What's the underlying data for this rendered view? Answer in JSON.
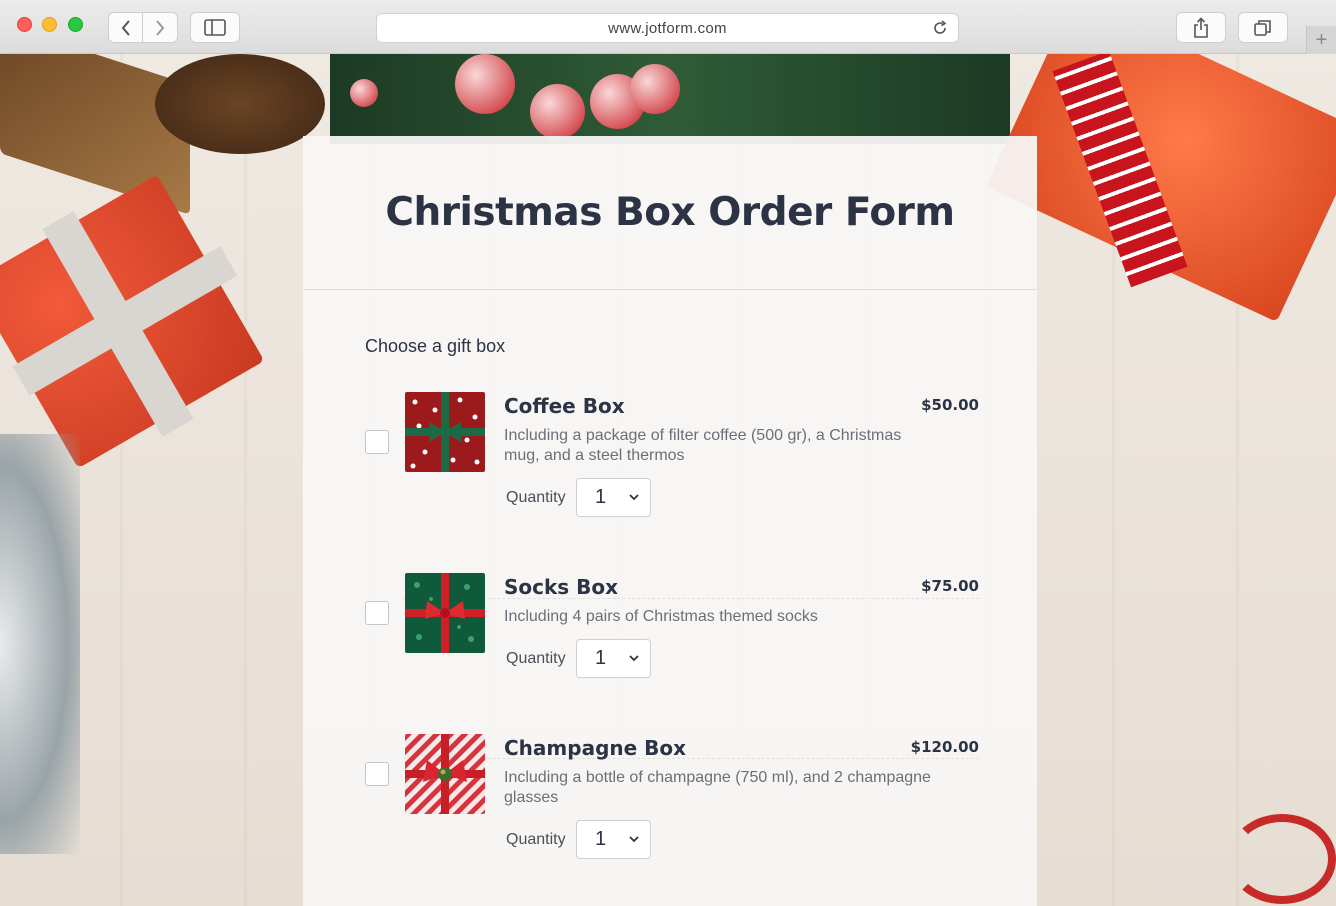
{
  "browser": {
    "url": "www.jotform.com"
  },
  "form": {
    "title": "Christmas Box Order Form",
    "field_label": "Choose a gift box",
    "quantity_label": "Quantity",
    "products": [
      {
        "name": "Coffee Box",
        "price": "$50.00",
        "description": "Including a package of filter coffee (500 gr), a Christmas mug, and a steel thermos",
        "quantity": "1",
        "checked": false,
        "thumb_color": "#9d1a1c",
        "ribbon_color": "#1d6b45"
      },
      {
        "name": "Socks Box",
        "price": "$75.00",
        "description": "Including 4 pairs of Christmas themed socks",
        "quantity": "1",
        "checked": false,
        "thumb_color": "#0f5a3b",
        "ribbon_color": "#d21f27"
      },
      {
        "name": "Champagne Box",
        "price": "$120.00",
        "description": "Including a bottle of champagne (750 ml), and 2 champagne glasses",
        "quantity": "1",
        "checked": false,
        "thumb_color": "#d8333c",
        "ribbon_color": "#c81e25"
      }
    ]
  },
  "colors": {
    "title": "#2c3345",
    "text_muted": "#6b6f78"
  }
}
